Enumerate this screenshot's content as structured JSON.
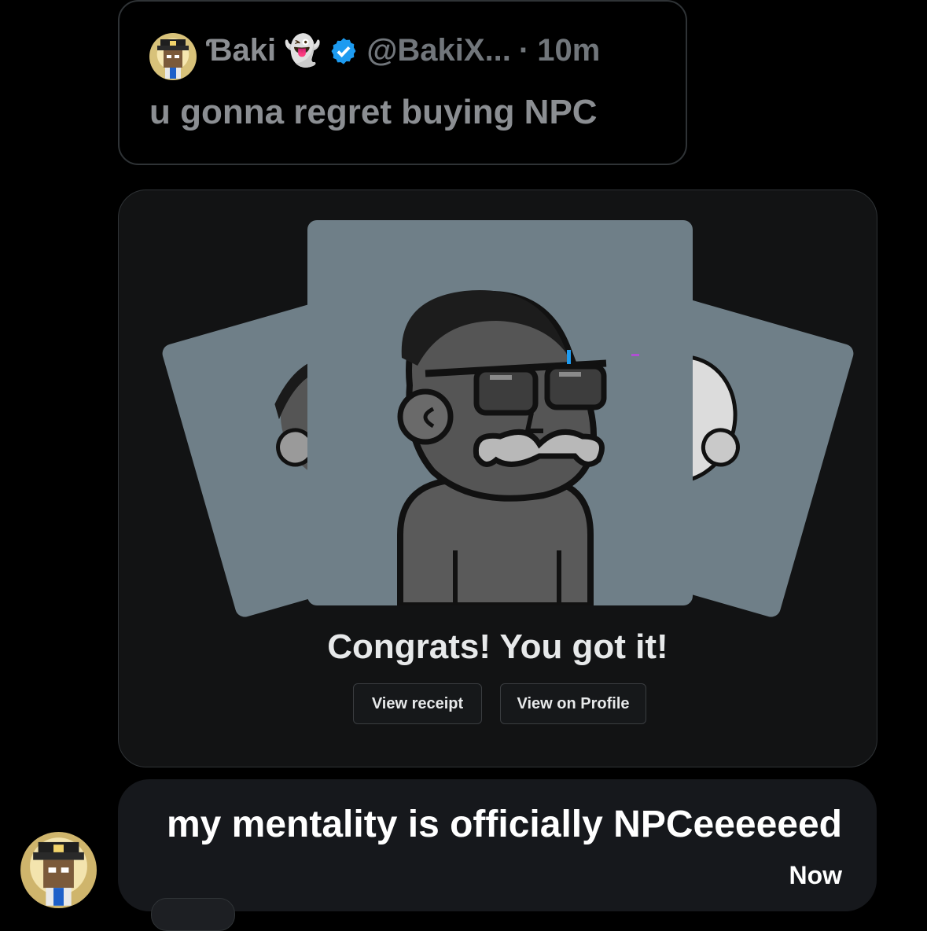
{
  "quote": {
    "name": "Ɓaki",
    "emoji": "👻",
    "handle": "@BakiX...",
    "dot": "·",
    "time": "10m",
    "text": "u gonna regret buying NPC",
    "verified_color": "#1d9bf0"
  },
  "purchase_card": {
    "headline": "Congrats! You got it!",
    "buttons": {
      "receipt": "View receipt",
      "profile": "View on Profile"
    },
    "nft_bg_color": "#6f7f88"
  },
  "message": {
    "text": "my mentality is officially NPCeeeeeed",
    "time": "Now"
  },
  "icons": {
    "avatar": "pirate-ape-avatar-icon",
    "verified": "verified-badge-icon",
    "nft": "npc-character-icon"
  }
}
